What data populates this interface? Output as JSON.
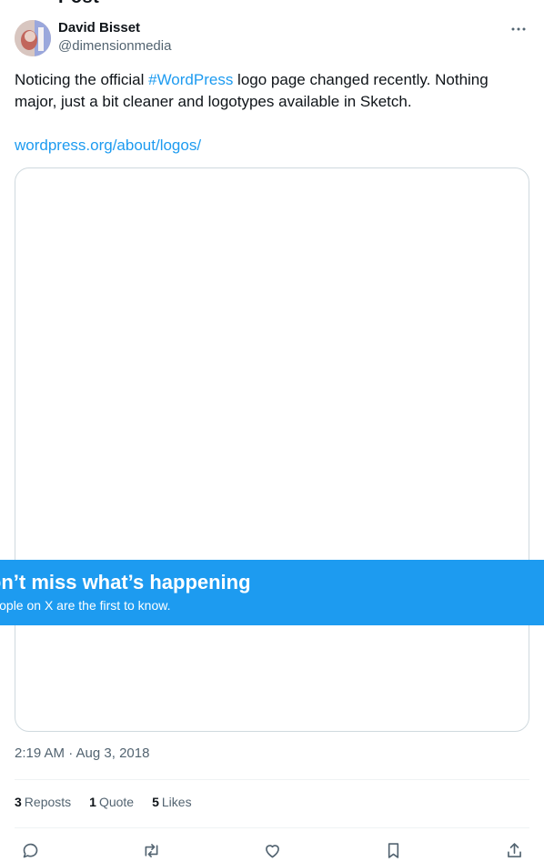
{
  "header": {
    "title_cut": "Post"
  },
  "author": {
    "name": "David Bisset",
    "handle": "@dimensionmedia",
    "avatar_icon": "avatar-photo"
  },
  "tweet": {
    "text_before": "Noticing the official ",
    "hashtag": "#WordPress",
    "text_after": " logo page changed recently. Nothing major, just a bit cleaner and logotypes available in Sketch.",
    "link": "wordpress.org/about/logos/"
  },
  "banner": {
    "title": "Don’t miss what’s happening",
    "subtitle": "People on X are the first to know."
  },
  "meta": {
    "timestamp": "2:19 AM · Aug 3, 2018"
  },
  "stats": {
    "reposts_count": "3",
    "reposts_label": "Reposts",
    "quotes_count": "1",
    "quotes_label": "Quote",
    "likes_count": "5",
    "likes_label": "Likes"
  },
  "colors": {
    "accent": "#1d9bf0",
    "text": "#0f1419",
    "muted": "#536471",
    "border": "#cfd9de"
  },
  "icons": [
    "more-icon",
    "reply-icon",
    "repost-icon",
    "like-icon",
    "bookmark-icon",
    "share-icon"
  ]
}
